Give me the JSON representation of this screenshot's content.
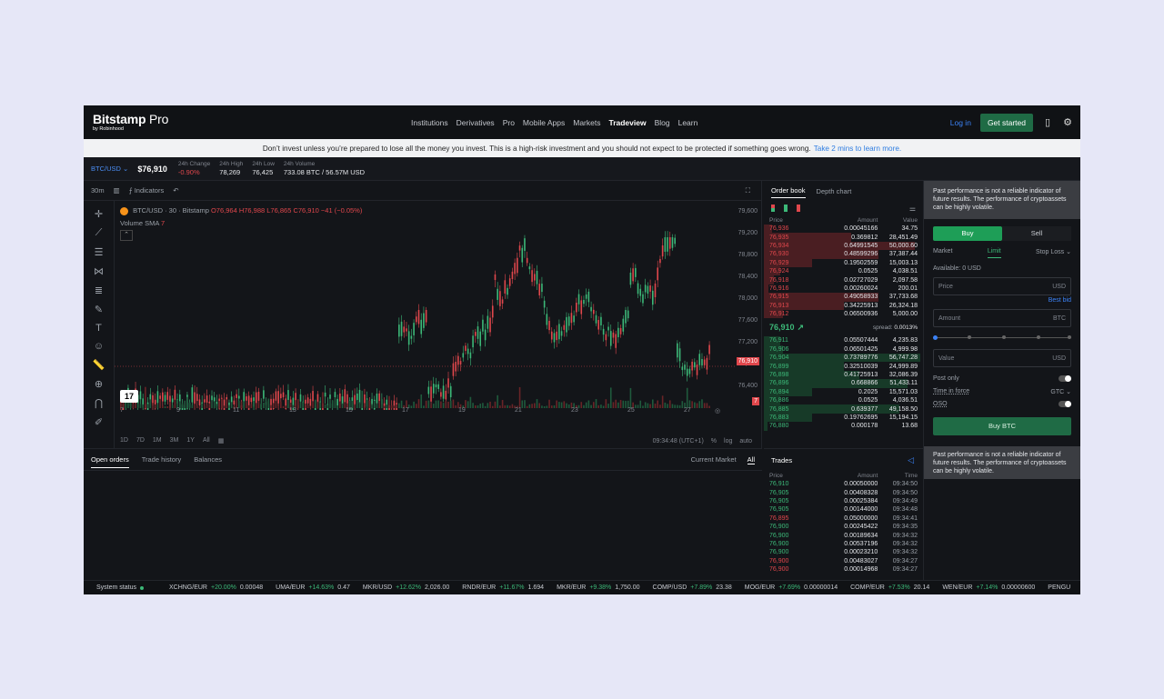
{
  "nav": {
    "brand": "Bitstamp",
    "brand_pro": " Pro",
    "brand_sub": "by Robinhood",
    "links": [
      "Institutions",
      "Derivatives",
      "Pro",
      "Mobile Apps",
      "Markets",
      "Tradeview",
      "Blog",
      "Learn"
    ],
    "active_link": "Tradeview",
    "login": "Log in",
    "get_started": "Get started"
  },
  "banner": {
    "text": "Don’t invest unless you’re prepared to lose all the money you invest. This is a high-risk investment and you should not expect to be protected if something goes wrong.",
    "link": "Take 2 mins to learn more."
  },
  "ticker": {
    "pair": "BTC/USD",
    "price": "$76,910",
    "change_label": "24h Change",
    "change_value": "-0.90%",
    "high_label": "24h High",
    "high_value": "78,269",
    "low_label": "24h Low",
    "low_value": "76,425",
    "volume_label": "24h Volume",
    "volume_value": "733.08 BTC / 56.57M USD"
  },
  "chart": {
    "interval": "30m",
    "indicators_label": "Indicators",
    "legend_symbol": "BTC/USD · 30 · Bitstamp",
    "legend_ohlc": "O76,964 H76,988 L76,865 C76,910 −41 (−0.05%)",
    "volume_label": "Volume SMA",
    "volume_value": "7",
    "y_ticks": [
      "79,600",
      "79,200",
      "78,800",
      "78,400",
      "78,000",
      "77,600",
      "77,200",
      "76,800",
      "76,400"
    ],
    "last_price_tag": "76,910",
    "volume_tag": "7",
    "x_ticks": [
      "7",
      "9",
      "11",
      "13",
      "15",
      "17",
      "19",
      "21",
      "23",
      "25",
      "27"
    ],
    "ranges": [
      "1D",
      "7D",
      "1M",
      "3M",
      "1Y",
      "All"
    ],
    "time_readout": "09:34:48 (UTC+1)",
    "scale_opts": [
      "%",
      "log",
      "auto"
    ]
  },
  "bottom": {
    "tabs": [
      "Open orders",
      "Trade history",
      "Balances"
    ],
    "right_tabs": [
      "Current Market",
      "All"
    ]
  },
  "orderbook": {
    "tabs": [
      "Order book",
      "Depth chart"
    ],
    "headers": [
      "Price",
      "Amount",
      "Value"
    ],
    "asks": [
      {
        "p": "76,936",
        "a": "0.00045166",
        "v": "34.75",
        "d": 0.05
      },
      {
        "p": "76,935",
        "a": "0.369812",
        "v": "28,451.49",
        "d": 0.55
      },
      {
        "p": "76,934",
        "a": "0.64991545",
        "v": "50,000.60",
        "d": 0.95
      },
      {
        "p": "76,930",
        "a": "0.48599296",
        "v": "37,387.44",
        "d": 0.72
      },
      {
        "p": "76,929",
        "a": "0.19502559",
        "v": "15,003.13",
        "d": 0.3
      },
      {
        "p": "76,924",
        "a": "0.0525",
        "v": "4,038.51",
        "d": 0.1
      },
      {
        "p": "76,918",
        "a": "0.02727029",
        "v": "2,097.58",
        "d": 0.06
      },
      {
        "p": "76,916",
        "a": "0.00260024",
        "v": "200.01",
        "d": 0.03
      },
      {
        "p": "76,915",
        "a": "0.49058933",
        "v": "37,733.68",
        "d": 0.72
      },
      {
        "p": "76,913",
        "a": "0.34225913",
        "v": "26,324.18",
        "d": 0.5
      },
      {
        "p": "76,912",
        "a": "0.06500936",
        "v": "5,000.00",
        "d": 0.12
      }
    ],
    "last_price": "76,910",
    "spread_label": "spread:",
    "spread_value": "0.0013%",
    "bids": [
      {
        "p": "76,911",
        "a": "0.05507444",
        "v": "4,235.83",
        "d": 0.1
      },
      {
        "p": "76,906",
        "a": "0.06501425",
        "v": "4,999.98",
        "d": 0.12
      },
      {
        "p": "76,904",
        "a": "0.73789776",
        "v": "56,747.28",
        "d": 0.98
      },
      {
        "p": "76,899",
        "a": "0.32510039",
        "v": "24,999.89",
        "d": 0.5
      },
      {
        "p": "76,898",
        "a": "0.41725913",
        "v": "32,086.39",
        "d": 0.6
      },
      {
        "p": "76,896",
        "a": "0.668866",
        "v": "51,433.11",
        "d": 0.9
      },
      {
        "p": "76,894",
        "a": "0.2025",
        "v": "15,571.03",
        "d": 0.3
      },
      {
        "p": "76,886",
        "a": "0.0525",
        "v": "4,036.51",
        "d": 0.1
      },
      {
        "p": "76,885",
        "a": "0.639377",
        "v": "49,158.50",
        "d": 0.85
      },
      {
        "p": "76,883",
        "a": "0.19762695",
        "v": "15,194.15",
        "d": 0.3
      },
      {
        "p": "76,880",
        "a": "0.000178",
        "v": "13.68",
        "d": 0.02
      }
    ]
  },
  "trades": {
    "title": "Trades",
    "headers": [
      "Price",
      "Amount",
      "Time"
    ],
    "rows": [
      {
        "p": "76,910",
        "a": "0.00050000",
        "t": "09:34:50",
        "s": "g"
      },
      {
        "p": "76,905",
        "a": "0.00408328",
        "t": "09:34:50",
        "s": "g"
      },
      {
        "p": "76,905",
        "a": "0.00025384",
        "t": "09:34:49",
        "s": "g"
      },
      {
        "p": "76,905",
        "a": "0.00144000",
        "t": "09:34:48",
        "s": "g"
      },
      {
        "p": "76,895",
        "a": "0.05000000",
        "t": "09:34:41",
        "s": "r"
      },
      {
        "p": "76,900",
        "a": "0.00245422",
        "t": "09:34:35",
        "s": "g"
      },
      {
        "p": "76,900",
        "a": "0.00189634",
        "t": "09:34:32",
        "s": "g"
      },
      {
        "p": "76,900",
        "a": "0.00537196",
        "t": "09:34:32",
        "s": "g"
      },
      {
        "p": "76,900",
        "a": "0.00023210",
        "t": "09:34:32",
        "s": "g"
      },
      {
        "p": "76,900",
        "a": "0.00483027",
        "t": "09:34:27",
        "s": "r"
      },
      {
        "p": "76,900",
        "a": "0.00014968",
        "t": "09:34:27",
        "s": "r"
      }
    ]
  },
  "form": {
    "warning": "Past performance is not a reliable indicator of future results. The performance of cryptoassets can be highly volatile.",
    "buy": "Buy",
    "sell": "Sell",
    "order_types": [
      "Market",
      "Limit",
      "Stop Loss ⌄"
    ],
    "available_label": "Available:",
    "available_value": "0 USD",
    "price_placeholder": "Price",
    "price_unit": "USD",
    "best_bid": "Best bid",
    "amount_placeholder": "Amount",
    "amount_unit": "BTC",
    "value_placeholder": "Value",
    "value_unit": "USD",
    "post_only": "Post only",
    "time_in_force": "Time in force",
    "tif_value": "GTC ⌄",
    "oso": "OSO",
    "submit": "Buy BTC"
  },
  "statusbar": {
    "system_status": "System status",
    "items": [
      {
        "pair": "XCHNG/EUR",
        "pct": "+20.00%",
        "price": "0.00048"
      },
      {
        "pair": "UMA/EUR",
        "pct": "+14.63%",
        "price": "0.47"
      },
      {
        "pair": "MKR/USD",
        "pct": "+12.62%",
        "price": "2,026.00"
      },
      {
        "pair": "RNDR/EUR",
        "pct": "+11.67%",
        "price": "1.694"
      },
      {
        "pair": "MKR/EUR",
        "pct": "+9.38%",
        "price": "1,750.00"
      },
      {
        "pair": "COMP/USD",
        "pct": "+7.89%",
        "price": "23.38"
      },
      {
        "pair": "MOG/EUR",
        "pct": "+7.69%",
        "price": "0.00000014"
      },
      {
        "pair": "COMP/EUR",
        "pct": "+7.53%",
        "price": "20.14"
      },
      {
        "pair": "WEN/EUR",
        "pct": "+7.14%",
        "price": "0.00000600"
      },
      {
        "pair": "PENGU",
        "pct": "",
        "price": ""
      }
    ]
  },
  "colors": {
    "green": "#3cb878",
    "red": "#e0474c",
    "accent_blue": "#3b82f6",
    "buy_button": "#1e9e57"
  }
}
